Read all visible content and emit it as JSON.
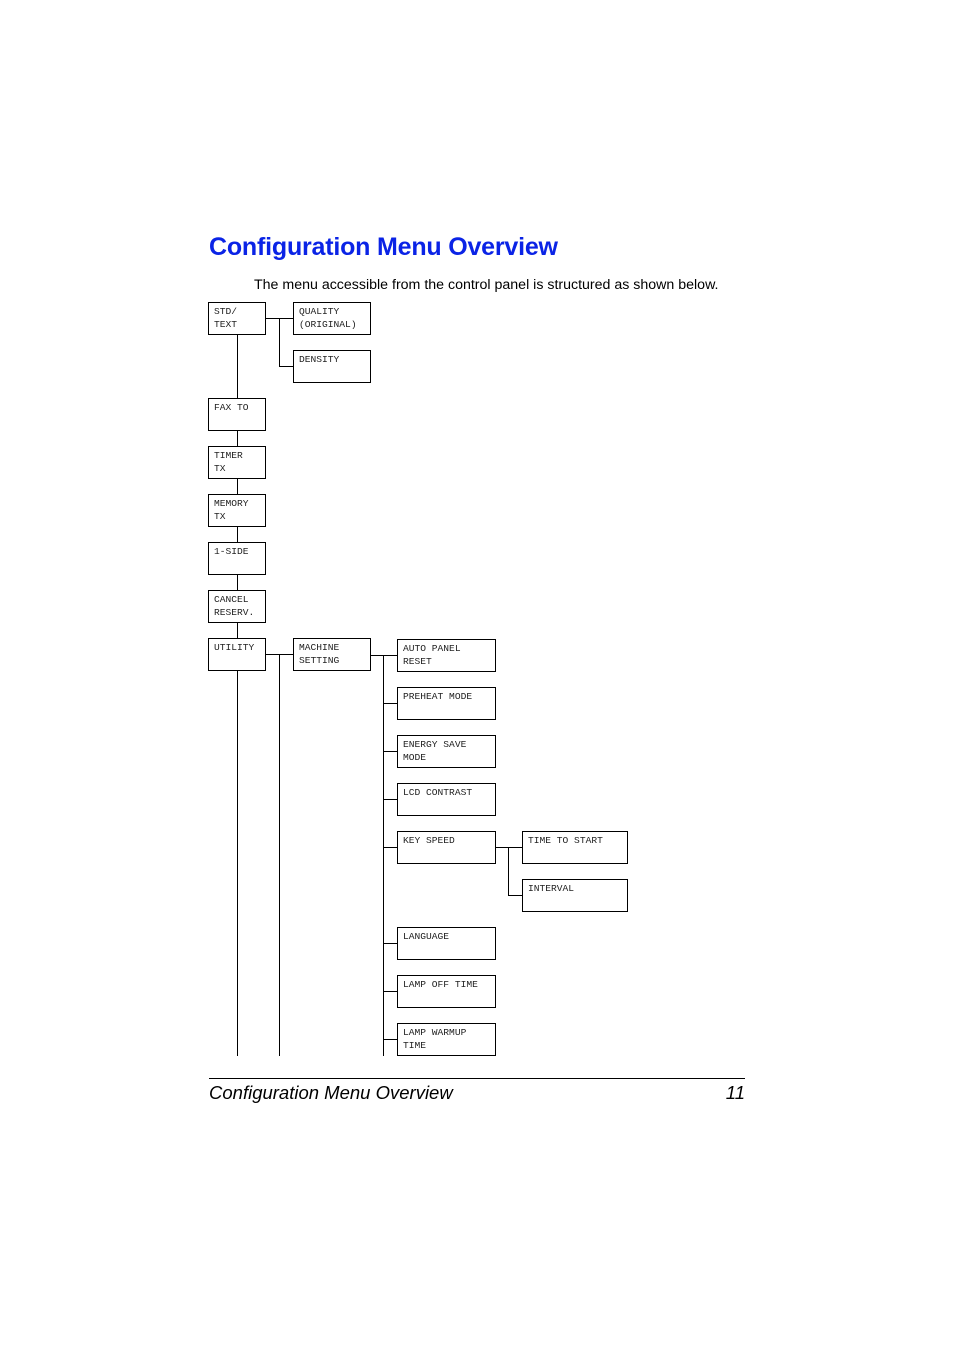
{
  "page": {
    "title": "Configuration Menu Overview",
    "intro": "The menu accessible from the control panel is structured as shown below.",
    "title_color": "#0a23e6"
  },
  "menu_tree": {
    "level1": [
      {
        "label": "STD/\nTEXT",
        "children": [
          "QUALITY\n(ORIGINAL)",
          "DENSITY"
        ]
      },
      {
        "label": "FAX TO"
      },
      {
        "label": "TIMER\nTX"
      },
      {
        "label": "MEMORY\nTX"
      },
      {
        "label": "1-SIDE"
      },
      {
        "label": "CANCEL\nRESERV."
      },
      {
        "label": "UTILITY"
      }
    ],
    "std_text_children": [
      "QUALITY\n(ORIGINAL)",
      "DENSITY"
    ],
    "utility_children": [
      "MACHINE\nSETTING"
    ],
    "machine_setting_children": [
      "AUTO PANEL\nRESET",
      "PREHEAT MODE",
      "ENERGY SAVE\nMODE",
      "LCD CONTRAST",
      "KEY SPEED",
      "LANGUAGE",
      "LAMP OFF TIME",
      "LAMP WARMUP\nTIME"
    ],
    "key_speed_children": [
      "TIME TO START",
      "INTERVAL"
    ]
  },
  "footer": {
    "section_title": "Configuration Menu Overview",
    "page_number": "11"
  }
}
